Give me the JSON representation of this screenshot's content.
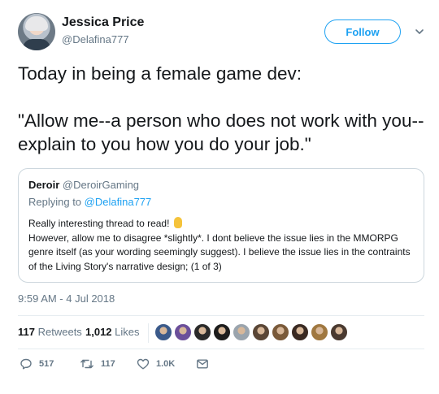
{
  "author": {
    "name": "Jessica Price",
    "handle": "@Delafina777",
    "follow_label": "Follow"
  },
  "tweet": {
    "line1": "Today in being a female game dev:",
    "line2": "\"Allow me--a person who does not work with you--explain to you how you do your job.\""
  },
  "quoted": {
    "name": "Deroir",
    "handle": "@DeroirGaming",
    "replying_prefix": "Replying to",
    "replying_to": "@Delafina777",
    "line1": "Really interesting thread to read!",
    "line2": "However, allow me to disagree *slightly*. I dont believe the issue lies in the MMORPG genre itself (as your wording seemingly suggest). I believe the issue lies in the contraints of the Living Story's narrative design; (1 of 3)"
  },
  "timestamp": "9:59 AM - 4 Jul 2018",
  "stats": {
    "retweets_count": "117",
    "retweets_label": "Retweets",
    "likes_count": "1,012",
    "likes_label": "Likes"
  },
  "likers": [
    "#3b5a8a",
    "#6b4f9a",
    "#2a2a2a",
    "#1c1c1c",
    "#9aa4ad",
    "#5a4636",
    "#7a5a3a",
    "#3a2a22",
    "#a07840",
    "#4a3a30"
  ],
  "actions": {
    "reply_count": "517",
    "retweet_count": "117",
    "like_count": "1.0K"
  },
  "colors": {
    "accent": "#1da1f2",
    "muted": "#657786",
    "border": "#ccd6dd"
  }
}
